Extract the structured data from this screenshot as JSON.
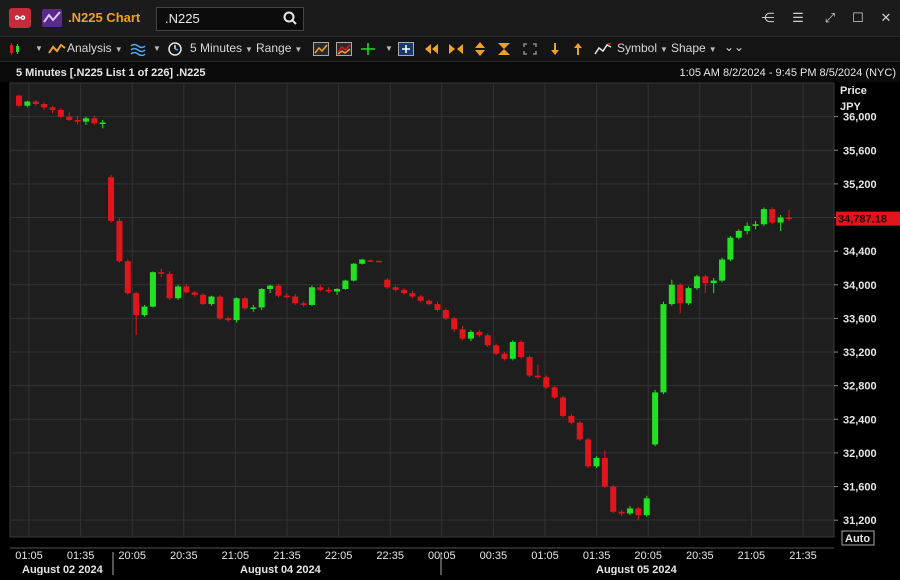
{
  "app": {
    "title": ".N225 Chart",
    "ric": ".N225"
  },
  "window_controls": [
    "share-icon",
    "menu-icon",
    "popout-icon",
    "maximize-icon",
    "close-icon"
  ],
  "toolbar": {
    "analysis": "Analysis",
    "interval": "5 Minutes",
    "range": "Range",
    "symbol": "Symbol",
    "shape": "Shape"
  },
  "header": {
    "left": "5 Minutes [.N225 List 1 of 226] .N225",
    "right": "1:05 AM 8/2/2024 - 9:45 PM 8/5/2024 (NYC)"
  },
  "colors": {
    "up": "#22e022",
    "down": "#e0161c",
    "accent": "#f0a028",
    "last_price_bg": "#e0161c"
  },
  "chart_data": {
    "type": "candlestick",
    "y_axis_title": [
      "Price",
      "JPY"
    ],
    "ylim": [
      31000,
      36400
    ],
    "y_ticks": [
      "36,000",
      "35,600",
      "35,200",
      "34,800",
      "34,400",
      "34,000",
      "33,600",
      "33,200",
      "32,800",
      "32,400",
      "32,000",
      "31,600",
      "31,200"
    ],
    "y_tick_values": [
      36000,
      35600,
      35200,
      34800,
      34400,
      34000,
      33600,
      33200,
      32800,
      32400,
      32000,
      31600,
      31200
    ],
    "x_ticks": [
      "01:05",
      "01:35",
      "20:05",
      "20:35",
      "21:05",
      "21:35",
      "22:05",
      "22:35",
      "00:05",
      "00:35",
      "01:05",
      "01:35",
      "20:05",
      "20:35",
      "21:05",
      "21:35"
    ],
    "date_labels": [
      "August 02 2024",
      "August 04 2024",
      "August 05 2024"
    ],
    "last_price_label": "34,787.18",
    "auto_label": "Auto",
    "candles": [
      {
        "o": 36250,
        "h": 36260,
        "l": 36110,
        "c": 36130
      },
      {
        "o": 36130,
        "h": 36190,
        "l": 36110,
        "c": 36180
      },
      {
        "o": 36180,
        "h": 36200,
        "l": 36130,
        "c": 36150
      },
      {
        "o": 36150,
        "h": 36170,
        "l": 36080,
        "c": 36110
      },
      {
        "o": 36110,
        "h": 36130,
        "l": 36040,
        "c": 36080
      },
      {
        "o": 36080,
        "h": 36100,
        "l": 35980,
        "c": 36000
      },
      {
        "o": 36000,
        "h": 36050,
        "l": 35950,
        "c": 35960
      },
      {
        "o": 35960,
        "h": 36010,
        "l": 35910,
        "c": 35940
      },
      {
        "o": 35940,
        "h": 36000,
        "l": 35900,
        "c": 35980
      },
      {
        "o": 35980,
        "h": 36010,
        "l": 35900,
        "c": 35920
      },
      {
        "o": 35920,
        "h": 35960,
        "l": 35860,
        "c": 35930
      },
      {
        "o": 35280,
        "h": 35310,
        "l": 34740,
        "c": 34760
      },
      {
        "o": 34760,
        "h": 34790,
        "l": 34260,
        "c": 34280
      },
      {
        "o": 34280,
        "h": 34300,
        "l": 33880,
        "c": 33900
      },
      {
        "o": 33900,
        "h": 33920,
        "l": 33400,
        "c": 33640
      },
      {
        "o": 33640,
        "h": 33760,
        "l": 33620,
        "c": 33740
      },
      {
        "o": 33740,
        "h": 34160,
        "l": 33730,
        "c": 34150
      },
      {
        "o": 34150,
        "h": 34190,
        "l": 34090,
        "c": 34130
      },
      {
        "o": 34130,
        "h": 34160,
        "l": 33820,
        "c": 33840
      },
      {
        "o": 33840,
        "h": 34000,
        "l": 33820,
        "c": 33980
      },
      {
        "o": 33980,
        "h": 34010,
        "l": 33900,
        "c": 33910
      },
      {
        "o": 33910,
        "h": 33930,
        "l": 33860,
        "c": 33880
      },
      {
        "o": 33880,
        "h": 33900,
        "l": 33760,
        "c": 33770
      },
      {
        "o": 33770,
        "h": 33870,
        "l": 33750,
        "c": 33860
      },
      {
        "o": 33860,
        "h": 33880,
        "l": 33580,
        "c": 33600
      },
      {
        "o": 33600,
        "h": 33620,
        "l": 33560,
        "c": 33580
      },
      {
        "o": 33580,
        "h": 33850,
        "l": 33550,
        "c": 33840
      },
      {
        "o": 33840,
        "h": 33860,
        "l": 33700,
        "c": 33720
      },
      {
        "o": 33720,
        "h": 33760,
        "l": 33680,
        "c": 33730
      },
      {
        "o": 33730,
        "h": 33960,
        "l": 33700,
        "c": 33950
      },
      {
        "o": 33950,
        "h": 34000,
        "l": 33900,
        "c": 33990
      },
      {
        "o": 33990,
        "h": 34010,
        "l": 33850,
        "c": 33870
      },
      {
        "o": 33870,
        "h": 33900,
        "l": 33840,
        "c": 33860
      },
      {
        "o": 33860,
        "h": 33890,
        "l": 33760,
        "c": 33780
      },
      {
        "o": 33780,
        "h": 33800,
        "l": 33740,
        "c": 33760
      },
      {
        "o": 33760,
        "h": 33990,
        "l": 33750,
        "c": 33970
      },
      {
        "o": 33970,
        "h": 34000,
        "l": 33920,
        "c": 33940
      },
      {
        "o": 33940,
        "h": 33970,
        "l": 33900,
        "c": 33920
      },
      {
        "o": 33920,
        "h": 33960,
        "l": 33880,
        "c": 33950
      },
      {
        "o": 33950,
        "h": 34060,
        "l": 33940,
        "c": 34050
      },
      {
        "o": 34050,
        "h": 34260,
        "l": 34040,
        "c": 34250
      },
      {
        "o": 34250,
        "h": 34310,
        "l": 34240,
        "c": 34300
      },
      {
        "o": 34290,
        "h": 34300,
        "l": 34280,
        "c": 34285
      },
      {
        "o": 34285,
        "h": 34290,
        "l": 34270,
        "c": 34280
      },
      {
        "o": 34060,
        "h": 34080,
        "l": 33950,
        "c": 33970
      },
      {
        "o": 33970,
        "h": 33990,
        "l": 33920,
        "c": 33940
      },
      {
        "o": 33940,
        "h": 33960,
        "l": 33880,
        "c": 33900
      },
      {
        "o": 33900,
        "h": 33930,
        "l": 33840,
        "c": 33860
      },
      {
        "o": 33860,
        "h": 33880,
        "l": 33790,
        "c": 33810
      },
      {
        "o": 33810,
        "h": 33830,
        "l": 33750,
        "c": 33770
      },
      {
        "o": 33770,
        "h": 33800,
        "l": 33680,
        "c": 33700
      },
      {
        "o": 33700,
        "h": 33720,
        "l": 33580,
        "c": 33600
      },
      {
        "o": 33600,
        "h": 33620,
        "l": 33440,
        "c": 33470
      },
      {
        "o": 33470,
        "h": 33510,
        "l": 33340,
        "c": 33360
      },
      {
        "o": 33360,
        "h": 33460,
        "l": 33330,
        "c": 33440
      },
      {
        "o": 33440,
        "h": 33460,
        "l": 33380,
        "c": 33400
      },
      {
        "o": 33400,
        "h": 33420,
        "l": 33260,
        "c": 33280
      },
      {
        "o": 33280,
        "h": 33300,
        "l": 33160,
        "c": 33180
      },
      {
        "o": 33180,
        "h": 33200,
        "l": 33100,
        "c": 33120
      },
      {
        "o": 33120,
        "h": 33340,
        "l": 33100,
        "c": 33320
      },
      {
        "o": 33320,
        "h": 33340,
        "l": 33120,
        "c": 33140
      },
      {
        "o": 33140,
        "h": 33160,
        "l": 32900,
        "c": 32920
      },
      {
        "o": 32920,
        "h": 33050,
        "l": 32880,
        "c": 32900
      },
      {
        "o": 32900,
        "h": 32920,
        "l": 32760,
        "c": 32780
      },
      {
        "o": 32780,
        "h": 32800,
        "l": 32640,
        "c": 32660
      },
      {
        "o": 32660,
        "h": 32680,
        "l": 32420,
        "c": 32440
      },
      {
        "o": 32440,
        "h": 32460,
        "l": 32340,
        "c": 32360
      },
      {
        "o": 32360,
        "h": 32380,
        "l": 32140,
        "c": 32160
      },
      {
        "o": 32160,
        "h": 32180,
        "l": 31820,
        "c": 31840
      },
      {
        "o": 31840,
        "h": 31960,
        "l": 31820,
        "c": 31940
      },
      {
        "o": 31940,
        "h": 32030,
        "l": 31580,
        "c": 31600
      },
      {
        "o": 31600,
        "h": 31620,
        "l": 31280,
        "c": 31300
      },
      {
        "o": 31300,
        "h": 31320,
        "l": 31250,
        "c": 31280
      },
      {
        "o": 31280,
        "h": 31370,
        "l": 31260,
        "c": 31340
      },
      {
        "o": 31340,
        "h": 31360,
        "l": 31200,
        "c": 31260
      },
      {
        "o": 31260,
        "h": 31490,
        "l": 31240,
        "c": 31460
      },
      {
        "o": 32100,
        "h": 32750,
        "l": 32080,
        "c": 32720
      },
      {
        "o": 32720,
        "h": 33800,
        "l": 32700,
        "c": 33770
      },
      {
        "o": 33770,
        "h": 34060,
        "l": 33750,
        "c": 34000
      },
      {
        "o": 34000,
        "h": 34020,
        "l": 33660,
        "c": 33780
      },
      {
        "o": 33780,
        "h": 33980,
        "l": 33760,
        "c": 33960
      },
      {
        "o": 33960,
        "h": 34120,
        "l": 33940,
        "c": 34100
      },
      {
        "o": 34100,
        "h": 34120,
        "l": 33900,
        "c": 34020
      },
      {
        "o": 34020,
        "h": 34080,
        "l": 33900,
        "c": 34050
      },
      {
        "o": 34050,
        "h": 34320,
        "l": 34030,
        "c": 34300
      },
      {
        "o": 34300,
        "h": 34580,
        "l": 34280,
        "c": 34560
      },
      {
        "o": 34560,
        "h": 34660,
        "l": 34540,
        "c": 34640
      },
      {
        "o": 34640,
        "h": 34740,
        "l": 34600,
        "c": 34700
      },
      {
        "o": 34700,
        "h": 34760,
        "l": 34660,
        "c": 34720
      },
      {
        "o": 34720,
        "h": 34920,
        "l": 34700,
        "c": 34900
      },
      {
        "o": 34900,
        "h": 34920,
        "l": 34720,
        "c": 34740
      },
      {
        "o": 34740,
        "h": 34830,
        "l": 34640,
        "c": 34800
      },
      {
        "o": 34800,
        "h": 34890,
        "l": 34760,
        "c": 34787
      }
    ]
  }
}
